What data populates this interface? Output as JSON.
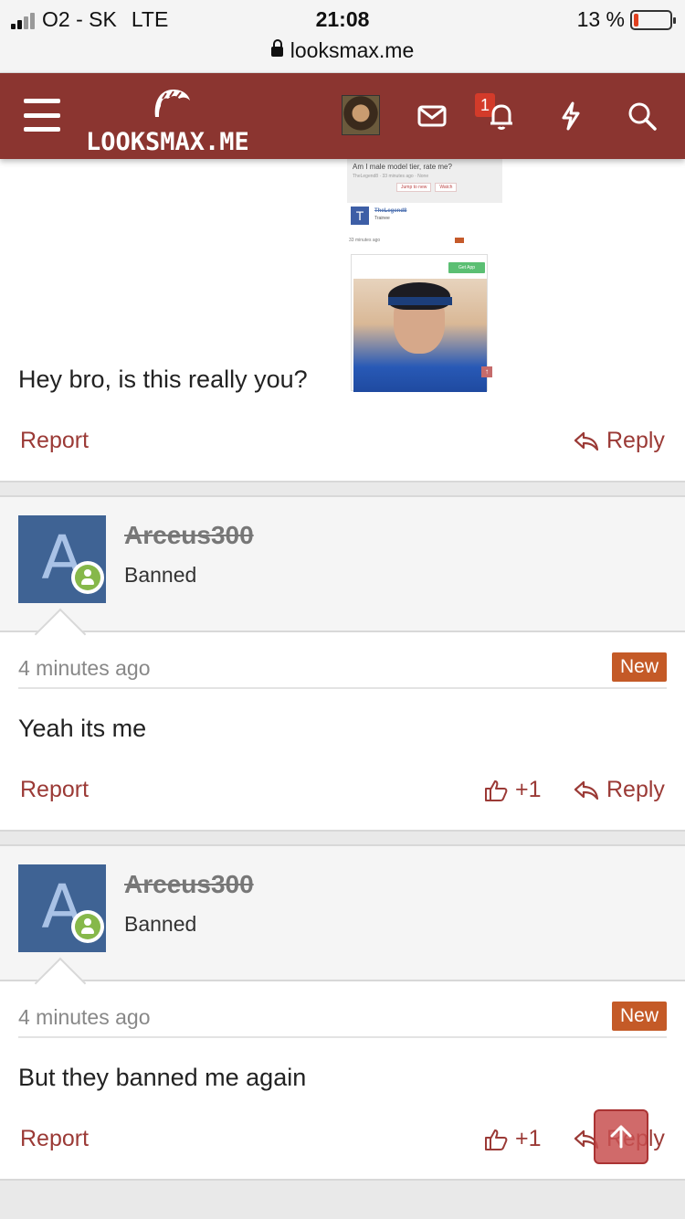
{
  "status_bar": {
    "carrier": "O2 - SK",
    "network": "LTE",
    "time": "21:08",
    "battery": "13 %",
    "url": "looksmax.me"
  },
  "header": {
    "logo_text": "LOOKSMAX.ME",
    "notification_count": "1"
  },
  "embed": {
    "title": "Am I male model tier, rate me?",
    "meta": "TheLegend8 · 33 minutes ago · None",
    "jump_label": "Jump to new",
    "watch_label": "Watch",
    "user": "TheLegend8",
    "user_initial": "T",
    "role": "Trainee",
    "ago": "33 minutes ago",
    "get_app": "Get App"
  },
  "post0": {
    "message": "Hey bro, is this really you?",
    "report": "Report",
    "reply": "Reply"
  },
  "posts": [
    {
      "initial": "A",
      "username": "Arceus300",
      "role": "Banned",
      "time": "4 minutes ago",
      "badge": "New",
      "message": "Yeah its me",
      "report": "Report",
      "likes": "+1",
      "reply": "Reply"
    },
    {
      "initial": "A",
      "username": "Arceus300",
      "role": "Banned",
      "time": "4 minutes ago",
      "badge": "New",
      "message": "But they banned me again",
      "report": "Report",
      "likes": "+1",
      "reply": "Reply"
    }
  ],
  "colors": {
    "brand": "#8b3530",
    "link": "#9b3a36",
    "new_badge": "#c45a27",
    "avatar": "#3f6394",
    "online": "#86b84a"
  }
}
